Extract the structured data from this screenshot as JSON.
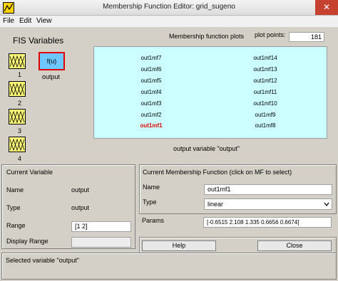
{
  "window": {
    "title": "Membership Function Editor: grid_sugeno",
    "close_glyph": "✕"
  },
  "menu": [
    "File",
    "Edit",
    "View"
  ],
  "fis_variables": {
    "title": "FIS Variables",
    "inputs": [
      "1",
      "2",
      "3",
      "4"
    ],
    "output_box_label": "f(u)",
    "output_label": "output"
  },
  "plots": {
    "title": "Membership function plots",
    "plot_points_label": "plot points:",
    "plot_points_value": "181",
    "left_column": [
      "out1mf7",
      "out1mf6",
      "out1mf5",
      "out1mf4",
      "out1mf3",
      "out1mf2",
      "out1mf1"
    ],
    "right_column": [
      "out1mf14",
      "out1mf13",
      "out1mf12",
      "out1mf11",
      "out1mf10",
      "out1mf9",
      "out1mf8"
    ],
    "selected": "out1mf1",
    "caption": "output variable \"output\""
  },
  "current_variable": {
    "title": "Current Variable",
    "name_label": "Name",
    "name_value": "output",
    "type_label": "Type",
    "type_value": "output",
    "range_label": "Range",
    "range_value": "[1 2]",
    "display_range_label": "Display Range",
    "display_range_value": ""
  },
  "current_mf": {
    "title": "Current Membership Function (click on MF to select)",
    "name_label": "Name",
    "name_value": "out1mf1",
    "type_label": "Type",
    "type_value": "linear",
    "params_label": "Params",
    "params_value": "[-0.6515 2.108 1.335 0.6656 0.6674]"
  },
  "buttons": {
    "help": "Help",
    "close": "Close"
  },
  "status": "Selected variable \"output\"",
  "colors": {
    "plot_background": "#ccffff",
    "selected_mf": "#e00000",
    "input_box": "#ffff77",
    "output_box": "#6ec8ff"
  },
  "icons": {
    "window_icon": "matlab-icon",
    "input_mf_icon": "triangle-mf-icon",
    "dropdown": "chevron-down-icon"
  }
}
